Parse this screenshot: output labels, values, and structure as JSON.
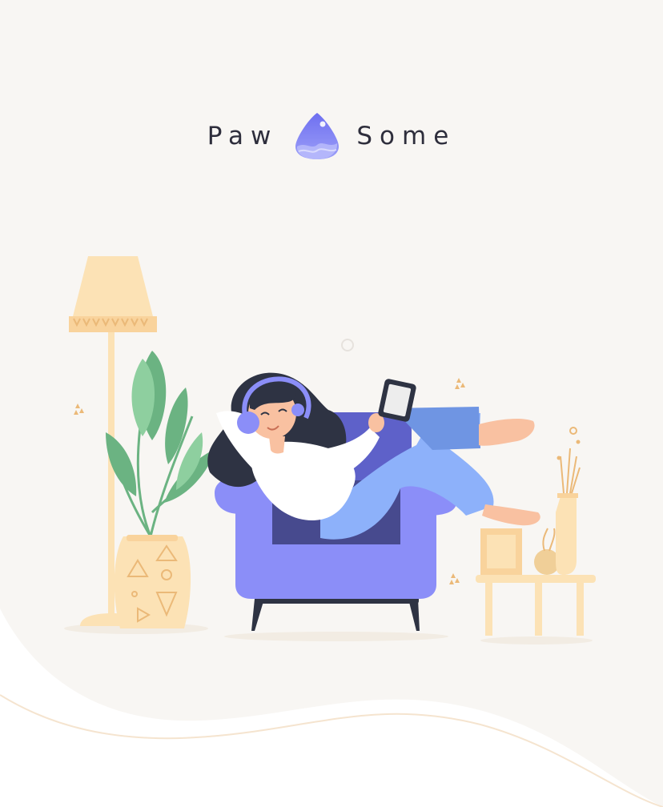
{
  "brand": {
    "left_word": "Paw",
    "right_word": "Some",
    "logo_icon": "water-drop-logo-icon"
  },
  "illustration": {
    "subject": "woman-reading-tablet-in-armchair",
    "colors": {
      "background": "#F8F6F3",
      "accent": "#8B8EF8",
      "accent_dark": "#5E61C9",
      "cream": "#FCE2B5",
      "leaf": "#6BB382",
      "hair": "#2E3343",
      "jeans": "#8DB1FA",
      "skin": "#F9C1A1"
    }
  }
}
